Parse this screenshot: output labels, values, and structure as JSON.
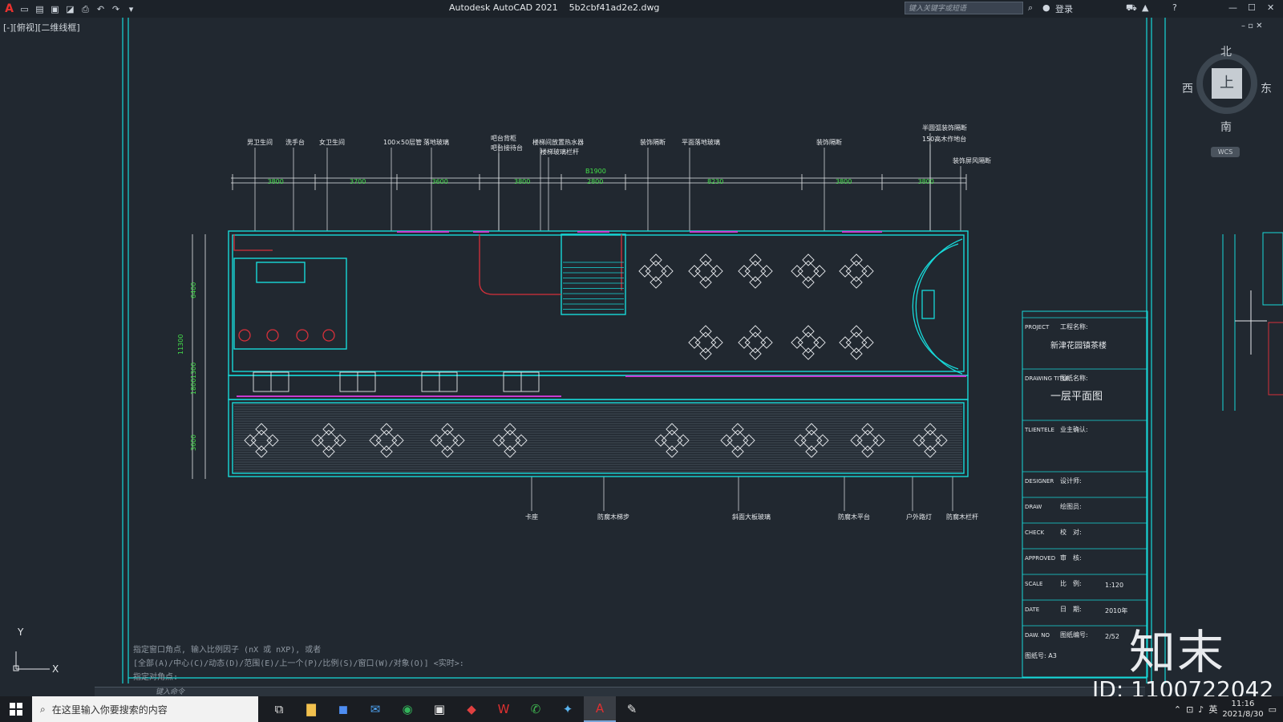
{
  "app": {
    "title": "Autodesk AutoCAD 2021",
    "file": "5b2cbf41ad2e2.dwg",
    "search_placeholder": "键入关键字或短语",
    "login": "登录",
    "viewport_label": "[-][俯视][二维线框]"
  },
  "viewcube": {
    "north": "北",
    "south": "南",
    "west": "西",
    "east": "东",
    "face": "上",
    "wcs": "WCS"
  },
  "drawing": {
    "top_labels": [
      "男卫生间",
      "洗手台",
      "女卫生间",
      "100×50层管",
      "落地玻璃",
      "吧台背柜",
      "吧台接待台",
      "楼梯间放置热水器",
      "楼梯玻璃栏杆",
      "装饰隔断",
      "平面落地玻璃",
      "装饰隔断",
      "半圆弧装饰隔断",
      "150高木作地台",
      "装饰屏风隔断"
    ],
    "dims_top": [
      "3800",
      "3700",
      "3600",
      "3800",
      "2800",
      "8230",
      "3800",
      "3800"
    ],
    "dim_extra": "B1900",
    "dims_left": [
      "6400",
      "11300",
      "1300",
      "1800",
      "3600"
    ],
    "bottom_labels": [
      "卡座",
      "防腐木梯步",
      "斜面大板玻璃",
      "防腐木平台",
      "户外路灯",
      "防腐木栏杆"
    ]
  },
  "title_block": {
    "rows": [
      {
        "en": "PROJECT",
        "cn": "工程名称:",
        "value": "新津花园镇茶楼"
      },
      {
        "en": "DRAWING TITLE",
        "cn": "图纸名称:",
        "value": "一层平面图"
      },
      {
        "en": "TLIENTELE",
        "cn": "业主确认:",
        "value": ""
      },
      {
        "en": "DESIGNER",
        "cn": "设计师:",
        "value": ""
      },
      {
        "en": "DRAW",
        "cn": "绘图员:",
        "value": ""
      },
      {
        "en": "CHECK",
        "cn": "校　对:",
        "value": ""
      },
      {
        "en": "APPROVED",
        "cn": "审　核:",
        "value": ""
      },
      {
        "en": "SCALE",
        "cn": "比　例:",
        "value": "1:120"
      },
      {
        "en": "DATE",
        "cn": "日　期:",
        "value": "2010年"
      },
      {
        "en": "DAW. NO",
        "cn": "图纸编号:",
        "value": "2/52"
      }
    ],
    "paper": "图纸号: A3"
  },
  "command": {
    "history": [
      "指定窗口角点, 输入比例因子 (nX 或 nXP), 或者",
      "[全部(A)/中心(C)/动态(D)/范围(E)/上一个(P)/比例(S)/窗口(W)/对象(O)] <实时>:",
      "指定对角点:"
    ],
    "input_placeholder": "键入命令"
  },
  "watermark": {
    "logo": "知末",
    "id": "ID: 1100722042"
  },
  "taskbar": {
    "search": "在这里输入你要搜索的内容",
    "apps": [
      "task-view",
      "file-explorer",
      "store",
      "mail",
      "browser",
      "photos",
      "presentation",
      "wps",
      "wechat",
      "bird-app",
      "autocad",
      "sketch-app"
    ],
    "time": "11:16",
    "date": "2021/8/30",
    "ime": "英"
  },
  "colors": {
    "cyan": "#17d9d9",
    "magenta": "#c83bd0",
    "red": "#d7303a",
    "white": "#e6e9ec",
    "green": "#44e04a",
    "background": "#212830"
  }
}
